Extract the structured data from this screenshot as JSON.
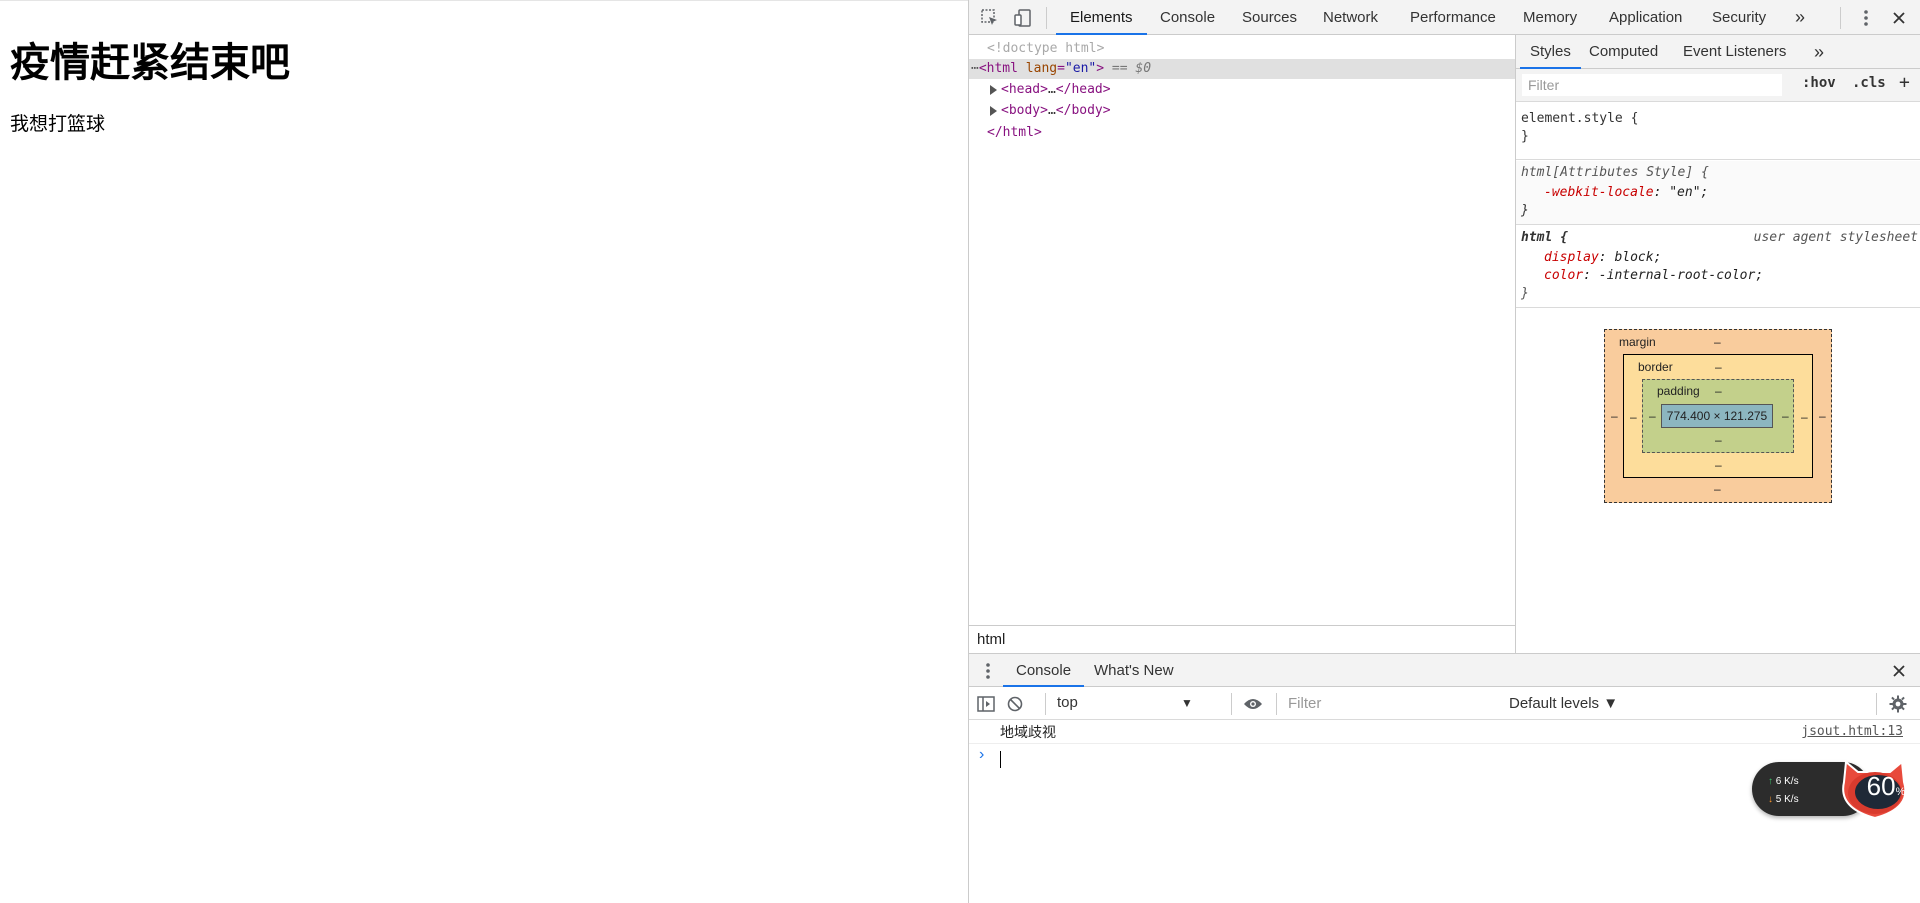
{
  "page": {
    "heading": "疫情赶紧结束吧",
    "paragraph": "我想打篮球"
  },
  "devtools": {
    "tabs": [
      "Elements",
      "Console",
      "Sources",
      "Network",
      "Performance",
      "Memory",
      "Application",
      "Security"
    ],
    "active_tab": "Elements",
    "more": "»"
  },
  "elements": {
    "doctype": "<!doctype html>",
    "html_open_tag": "html",
    "lang_attr": "lang",
    "lang_value": "\"en\"",
    "selected_marker": "== $0",
    "head_line": "…",
    "body_line": "…",
    "html_close": "</html>",
    "breadcrumb": "html"
  },
  "styles": {
    "tabs": [
      "Styles",
      "Computed",
      "Event Listeners"
    ],
    "more": "»",
    "filter_placeholder": "Filter",
    "hov": ":hov",
    "cls": ".cls",
    "add": "+",
    "rules": {
      "element_style": "element.style {",
      "close": "}",
      "attr_selector": "html[Attributes Style] {",
      "locale_prop": "-webkit-locale",
      "locale_val": "\"en\";",
      "html_selector": "html {",
      "ua_source": "user agent stylesheet",
      "display_prop": "display",
      "display_val": "block;",
      "color_prop": "color",
      "color_val": "-internal-root-color;"
    },
    "box_model": {
      "margin_label": "margin",
      "border_label": "border",
      "padding_label": "padding",
      "dash": "–",
      "content_size": "774.400 × 121.275"
    }
  },
  "drawer": {
    "tabs": [
      "Console",
      "What's New"
    ],
    "context": "top",
    "filter_placeholder": "Filter",
    "levels": "Default levels ▼",
    "message": "地域歧视",
    "source_link": "jsout.html:13",
    "prompt": "›"
  },
  "netmon": {
    "up": "6  K/s",
    "down": "5  K/s",
    "percent": "60",
    "percent_sign": "%"
  }
}
